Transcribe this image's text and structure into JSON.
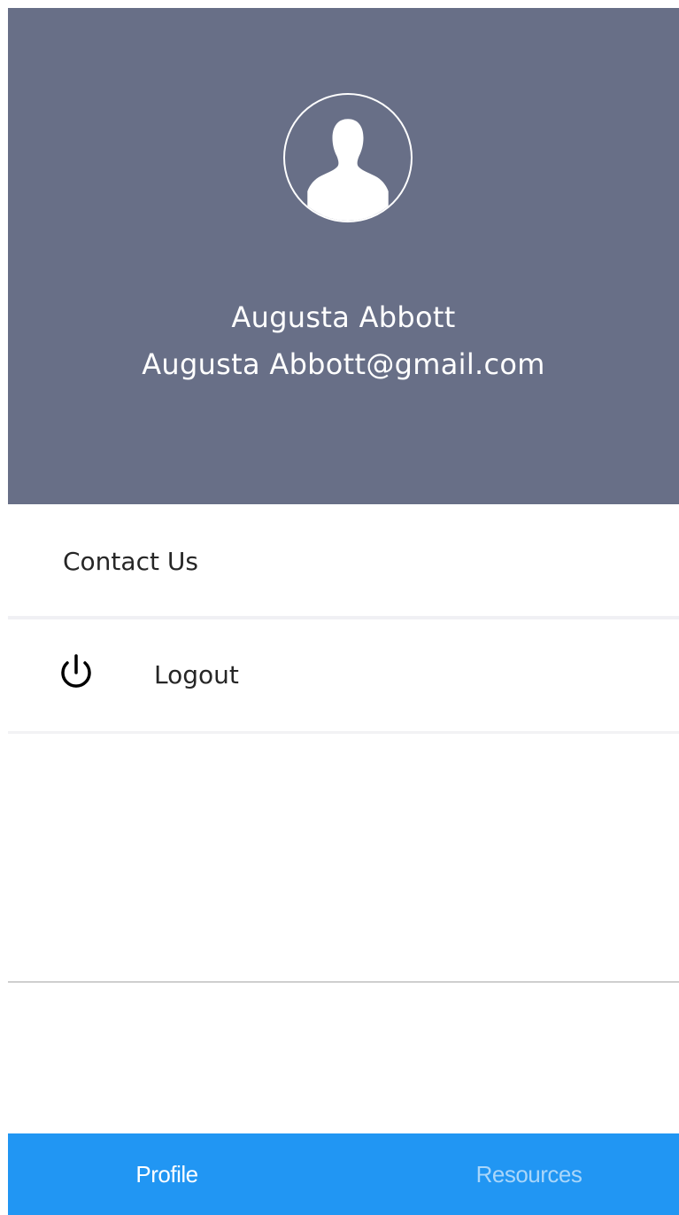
{
  "header": {
    "background_color": "#686f87",
    "avatar_icon": "user-silhouette-icon",
    "user_name": "Augusta Abbott",
    "user_email": "Augusta Abbott@gmail.com"
  },
  "menu": {
    "items": [
      {
        "label": "Contact Us"
      },
      {
        "label": "Logout",
        "icon": "power-icon"
      }
    ]
  },
  "tab_bar": {
    "background_color": "#2196f3",
    "tabs": [
      {
        "label": "Profile",
        "active": true
      },
      {
        "label": "Resources",
        "active": false
      }
    ]
  }
}
